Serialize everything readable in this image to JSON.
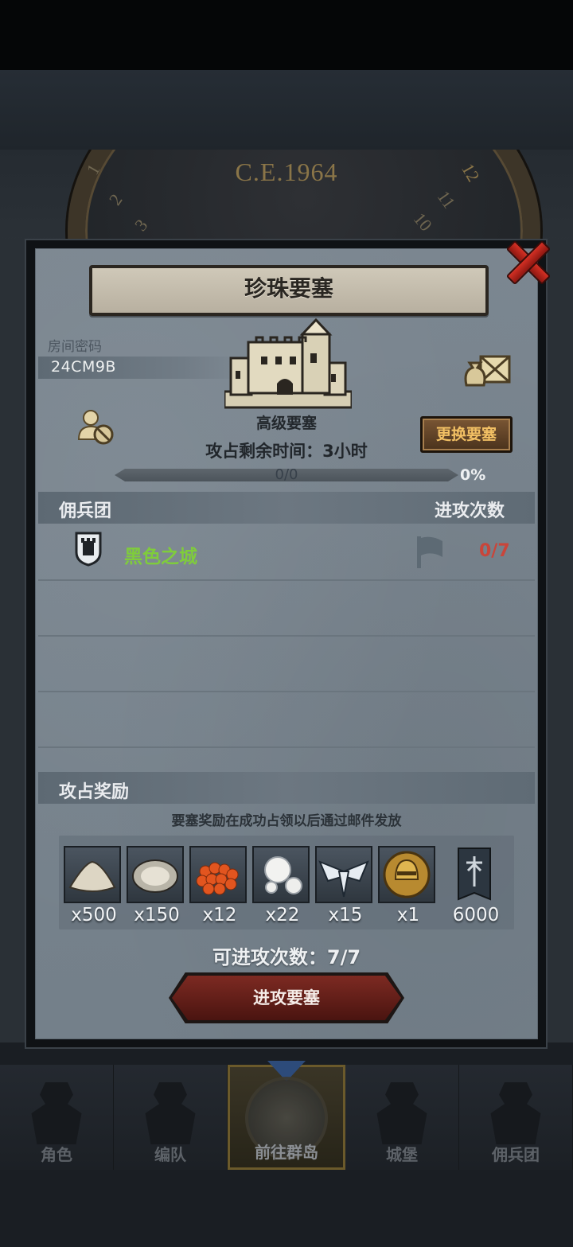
{
  "background": {
    "clock_year": "C.E.1964",
    "clock_numerals": [
      "1",
      "2",
      "3",
      "10",
      "11",
      "12"
    ]
  },
  "dialog": {
    "title": "珍珠要塞",
    "room_password_label": "房间密码",
    "room_code": "24CM9B",
    "fortress_level": "高级要塞",
    "occupation_time": "攻占剩余时间：3小时",
    "change_button": "更换要塞",
    "progress": {
      "text": "0/0",
      "percent_label": "0%",
      "fraction": 0
    },
    "columns": {
      "mercenary": "佣兵团",
      "attacks": "进攻次数"
    },
    "guilds": [
      {
        "name": "黑色之城",
        "attacks": "0/7"
      }
    ],
    "rewards_title": "攻占奖励",
    "rewards_note": "要塞奖励在成功占领以后通过邮件发放",
    "rewards": [
      {
        "icon": "sand-pile-icon",
        "count": "x500"
      },
      {
        "icon": "oyster-icon",
        "count": "x150"
      },
      {
        "icon": "fish-roe-icon",
        "count": "x12"
      },
      {
        "icon": "pearls-icon",
        "count": "x22"
      },
      {
        "icon": "winged-emblem-icon",
        "count": "x15"
      },
      {
        "icon": "golden-helmet-medal-icon",
        "count": "x1"
      },
      {
        "icon": "guild-banner-icon",
        "count": "6000"
      }
    ],
    "attacks_remaining": "可进攻次数：7/7",
    "attack_button": "进攻要塞"
  },
  "nav": [
    {
      "label": "角色",
      "active": false
    },
    {
      "label": "编队",
      "active": false
    },
    {
      "label": "前往群岛",
      "active": true
    },
    {
      "label": "城堡",
      "active": false
    },
    {
      "label": "佣兵团",
      "active": false
    }
  ],
  "colors": {
    "guild_name": "#7fcc3c",
    "attack_count": "#c9453a",
    "change_button_text": "#f2c064",
    "attack_button": "#7d2a22"
  }
}
